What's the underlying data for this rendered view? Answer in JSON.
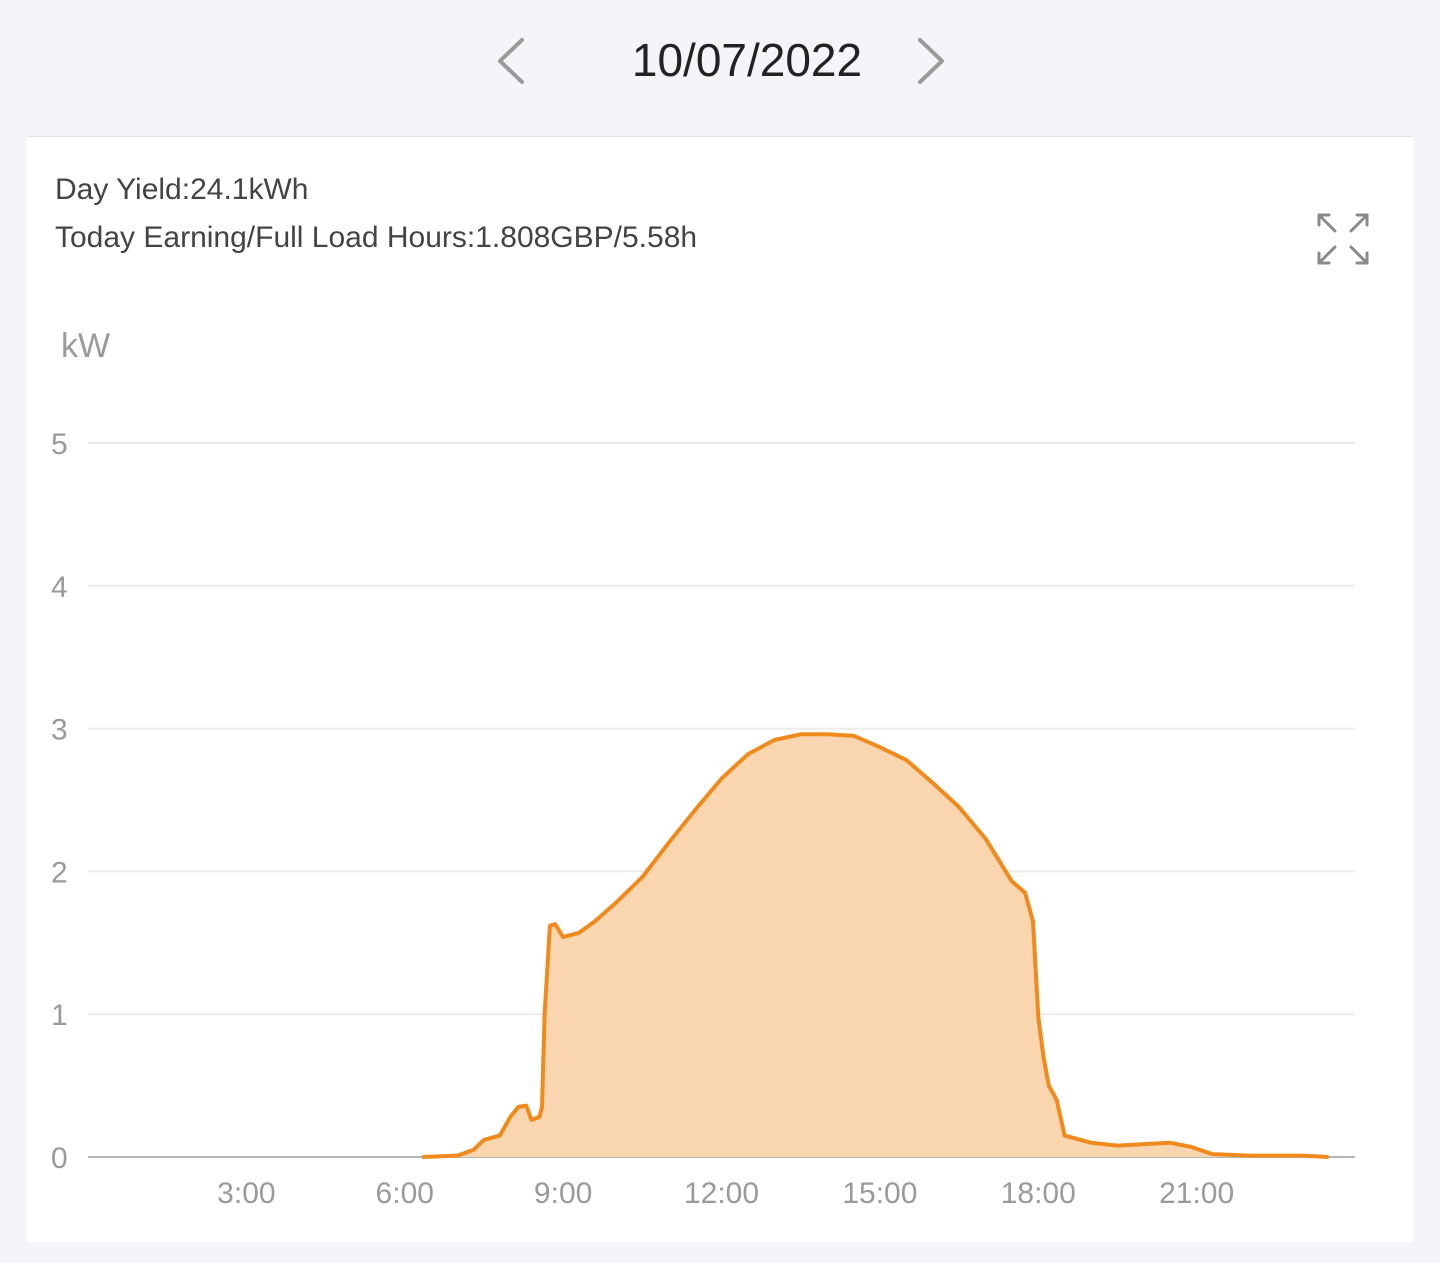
{
  "header": {
    "date": "10/07/2022",
    "prev_icon": "chevron-left-icon",
    "next_icon": "chevron-right-icon"
  },
  "summary": {
    "day_yield": "Day Yield:24.1kWh",
    "earning_hours": "Today Earning/Full Load Hours:1.808GBP/5.58h",
    "expand_icon": "expand-icon"
  },
  "colors": {
    "line": "#f08a1c",
    "fill": "#f9d5b0",
    "grid": "#ececec",
    "axis_text": "#9a9a9a"
  },
  "chart_data": {
    "type": "area",
    "ylabel": "kW",
    "xlabel": "",
    "ylim": [
      0,
      5
    ],
    "xlim": [
      0,
      24
    ],
    "yticks": [
      "0",
      "1",
      "2",
      "3",
      "4",
      "5"
    ],
    "xticks": [
      "3:00",
      "6:00",
      "9:00",
      "12:00",
      "15:00",
      "18:00",
      "21:00"
    ],
    "series": [
      {
        "values": [
          [
            6.33,
            0
          ],
          [
            7.0,
            0.01
          ],
          [
            7.3,
            0.05
          ],
          [
            7.5,
            0.12
          ],
          [
            7.8,
            0.15
          ],
          [
            8.0,
            0.28
          ],
          [
            8.15,
            0.35
          ],
          [
            8.3,
            0.36
          ],
          [
            8.4,
            0.26
          ],
          [
            8.55,
            0.28
          ],
          [
            8.6,
            0.35
          ],
          [
            8.65,
            1.0
          ],
          [
            8.75,
            1.62
          ],
          [
            8.85,
            1.63
          ],
          [
            9.0,
            1.54
          ],
          [
            9.3,
            1.57
          ],
          [
            9.6,
            1.65
          ],
          [
            10.0,
            1.78
          ],
          [
            10.5,
            1.96
          ],
          [
            11.0,
            2.2
          ],
          [
            11.5,
            2.43
          ],
          [
            12.0,
            2.65
          ],
          [
            12.5,
            2.82
          ],
          [
            13.0,
            2.92
          ],
          [
            13.5,
            2.96
          ],
          [
            14.0,
            2.96
          ],
          [
            14.5,
            2.95
          ],
          [
            15.0,
            2.87
          ],
          [
            15.5,
            2.78
          ],
          [
            16.0,
            2.62
          ],
          [
            16.5,
            2.45
          ],
          [
            17.0,
            2.23
          ],
          [
            17.5,
            1.93
          ],
          [
            17.75,
            1.85
          ],
          [
            17.9,
            1.65
          ],
          [
            18.0,
            0.98
          ],
          [
            18.1,
            0.7
          ],
          [
            18.2,
            0.5
          ],
          [
            18.35,
            0.4
          ],
          [
            18.5,
            0.15
          ],
          [
            19.0,
            0.1
          ],
          [
            19.5,
            0.08
          ],
          [
            20.0,
            0.09
          ],
          [
            20.5,
            0.1
          ],
          [
            20.9,
            0.07
          ],
          [
            21.3,
            0.02
          ],
          [
            22.0,
            0.01
          ],
          [
            23.0,
            0.01
          ],
          [
            23.5,
            0
          ]
        ]
      }
    ]
  }
}
